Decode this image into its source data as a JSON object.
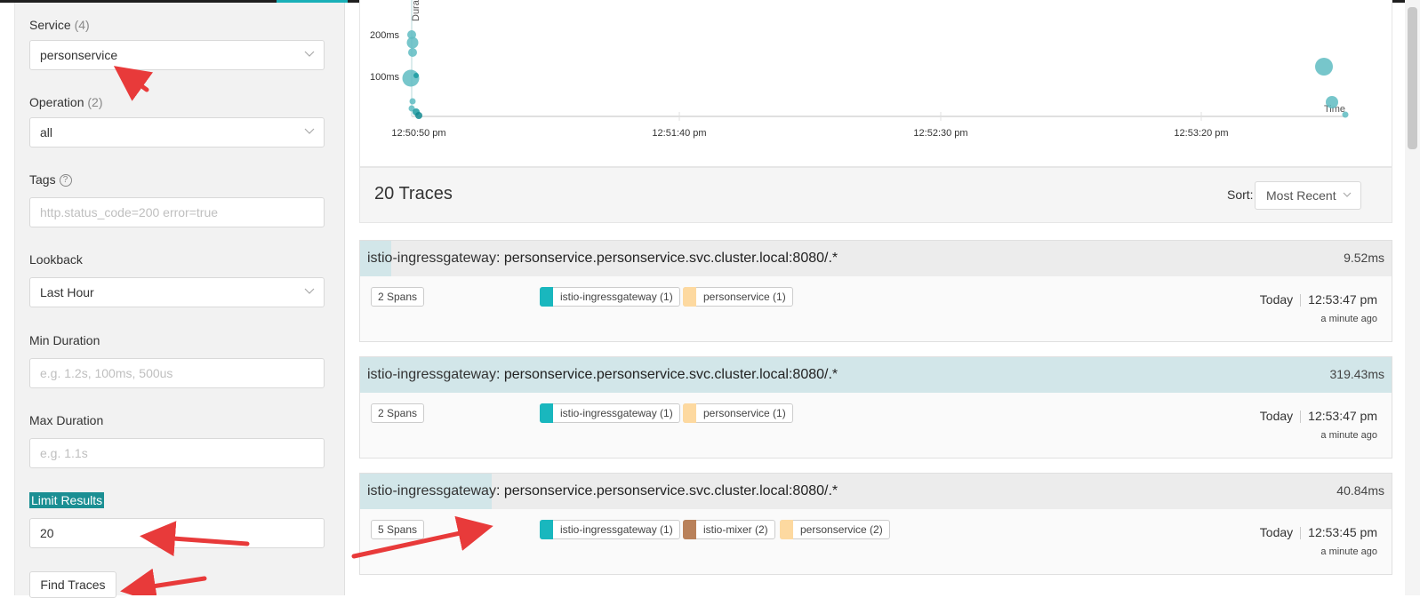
{
  "colors": {
    "accent": "#1b8f93",
    "point": "#5fbcc2",
    "ingress": "#19b7be",
    "mixer": "#b9815a",
    "personservice": "#fdd9a0",
    "arrow": "#e83a3a"
  },
  "search": {
    "service_label": "Service",
    "service_count": "(4)",
    "service_value": "personservice",
    "operation_label": "Operation",
    "operation_count": "(2)",
    "operation_value": "all",
    "tags_label": "Tags",
    "tags_placeholder": "http.status_code=200 error=true",
    "lookback_label": "Lookback",
    "lookback_value": "Last Hour",
    "min_duration_label": "Min Duration",
    "min_duration_placeholder": "e.g. 1.2s, 100ms, 500us",
    "max_duration_label": "Max Duration",
    "max_duration_placeholder": "e.g. 1.1s",
    "limit_label": "Limit Results",
    "limit_value": "20",
    "find_button": "Find Traces"
  },
  "scatter": {
    "y_axis_label": "Duration",
    "x_axis_label": "Time",
    "y_ticks": [
      "200ms",
      "100ms"
    ],
    "x_ticks": [
      "12:50:50 pm",
      "12:51:40 pm",
      "12:52:30 pm",
      "12:53:20 pm"
    ]
  },
  "results": {
    "count_title": "20 Traces",
    "sort_label": "Sort:",
    "sort_value": "Most Recent"
  },
  "traces": [
    {
      "service": "istio-ingressgateway",
      "operation": ": personservice.personservice.svc.cluster.local:8080/.*",
      "duration": "9.52ms",
      "duration_fraction": 0.03,
      "spans": "2 Spans",
      "services": [
        {
          "name": "istio-ingressgateway (1)",
          "color": "#19b7be"
        },
        {
          "name": "personservice (1)",
          "color": "#fdd9a0"
        }
      ],
      "date": "Today",
      "time": "12:53:47 pm",
      "ago": "a minute ago"
    },
    {
      "service": "istio-ingressgateway",
      "operation": ": personservice.personservice.svc.cluster.local:8080/.*",
      "duration": "319.43ms",
      "duration_fraction": 1.0,
      "spans": "2 Spans",
      "services": [
        {
          "name": "istio-ingressgateway (1)",
          "color": "#19b7be"
        },
        {
          "name": "personservice (1)",
          "color": "#fdd9a0"
        }
      ],
      "date": "Today",
      "time": "12:53:47 pm",
      "ago": "a minute ago"
    },
    {
      "service": "istio-ingressgateway",
      "operation": ": personservice.personservice.svc.cluster.local:8080/.*",
      "duration": "40.84ms",
      "duration_fraction": 0.128,
      "spans": "5 Spans",
      "services": [
        {
          "name": "istio-ingressgateway (1)",
          "color": "#19b7be"
        },
        {
          "name": "istio-mixer (2)",
          "color": "#b9815a"
        },
        {
          "name": "personservice (2)",
          "color": "#fdd9a0"
        }
      ],
      "date": "Today",
      "time": "12:53:45 pm",
      "ago": "a minute ago"
    }
  ]
}
